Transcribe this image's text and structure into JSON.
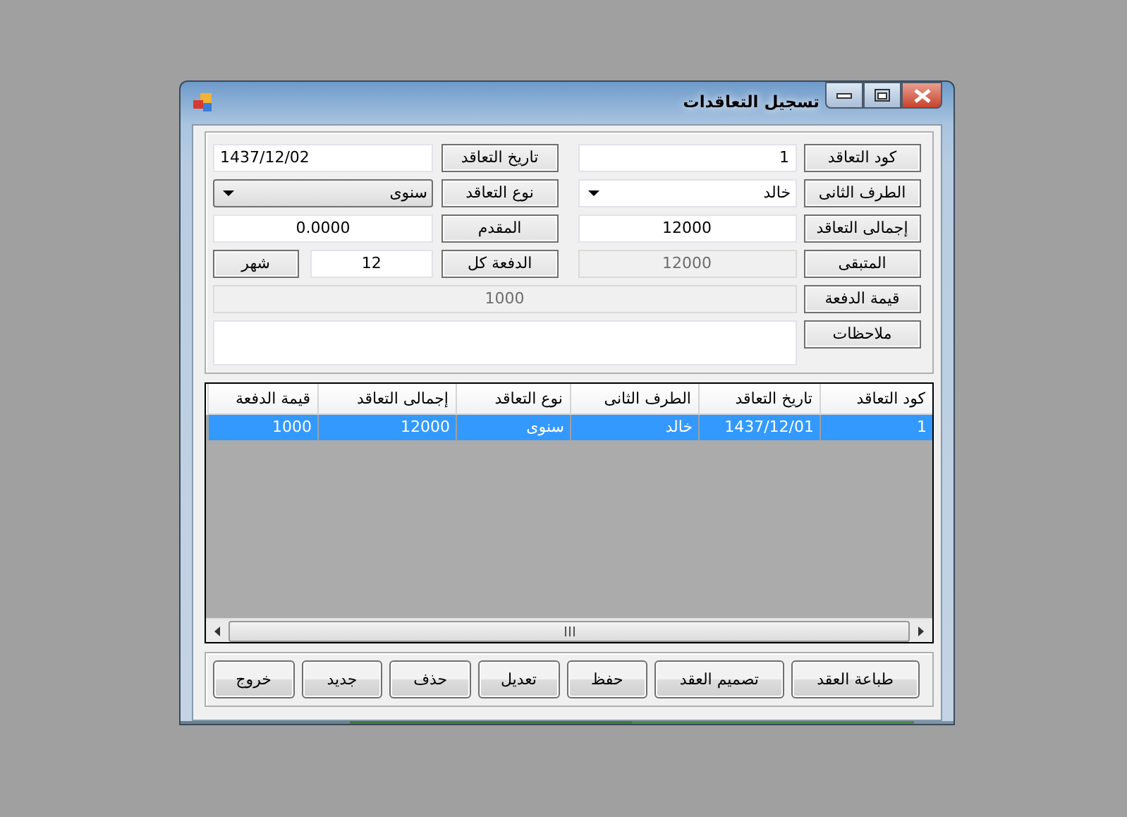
{
  "window": {
    "title": "تسجيل التعاقدات"
  },
  "form": {
    "fields": [
      {
        "label": "كود التعاقد",
        "kind": "text",
        "value": "1",
        "disabled": false
      },
      {
        "label": "تاريخ التعاقد",
        "kind": "text",
        "value": "1437/12/02",
        "disabled": false
      },
      {
        "label": "الطرف الثانى",
        "kind": "combo",
        "value": "خالد",
        "editable": true
      },
      {
        "label": "نوع التعاقد",
        "kind": "combo",
        "value": "سنوى",
        "editable": false
      },
      {
        "label": "إجمالى التعاقد",
        "kind": "text",
        "value": "12000",
        "disabled": false
      },
      {
        "label": "المقدم",
        "kind": "text",
        "value": "0.0000",
        "disabled": false
      },
      {
        "label": "المتبقى",
        "kind": "text",
        "value": "12000",
        "disabled": true
      },
      {
        "label": "الدفعة كل",
        "kind": "text",
        "value": "12",
        "disabled": false,
        "unit": "شهر"
      },
      {
        "label": "قيمة الدفعة",
        "kind": "text",
        "value": "1000",
        "disabled": true
      },
      {
        "label": "ملاحظات",
        "kind": "textarea",
        "disabled": false
      }
    ]
  },
  "table": {
    "columns": [
      "كود التعاقد",
      "تاريخ التعاقد",
      "الطرف الثانى",
      "نوع التعاقد",
      "إجمالى التعاقد",
      "قيمة الدفعة"
    ],
    "rows": [
      {
        "selected": true,
        "cells": [
          "1",
          "1437/12/01",
          "خالد",
          "سنوى",
          "12000",
          "1000"
        ]
      }
    ]
  },
  "buttons": [
    "طباعة العقد",
    "تصميم العقد",
    "حفظ",
    "تعديل",
    "حذف",
    "جديد",
    "خروج"
  ]
}
